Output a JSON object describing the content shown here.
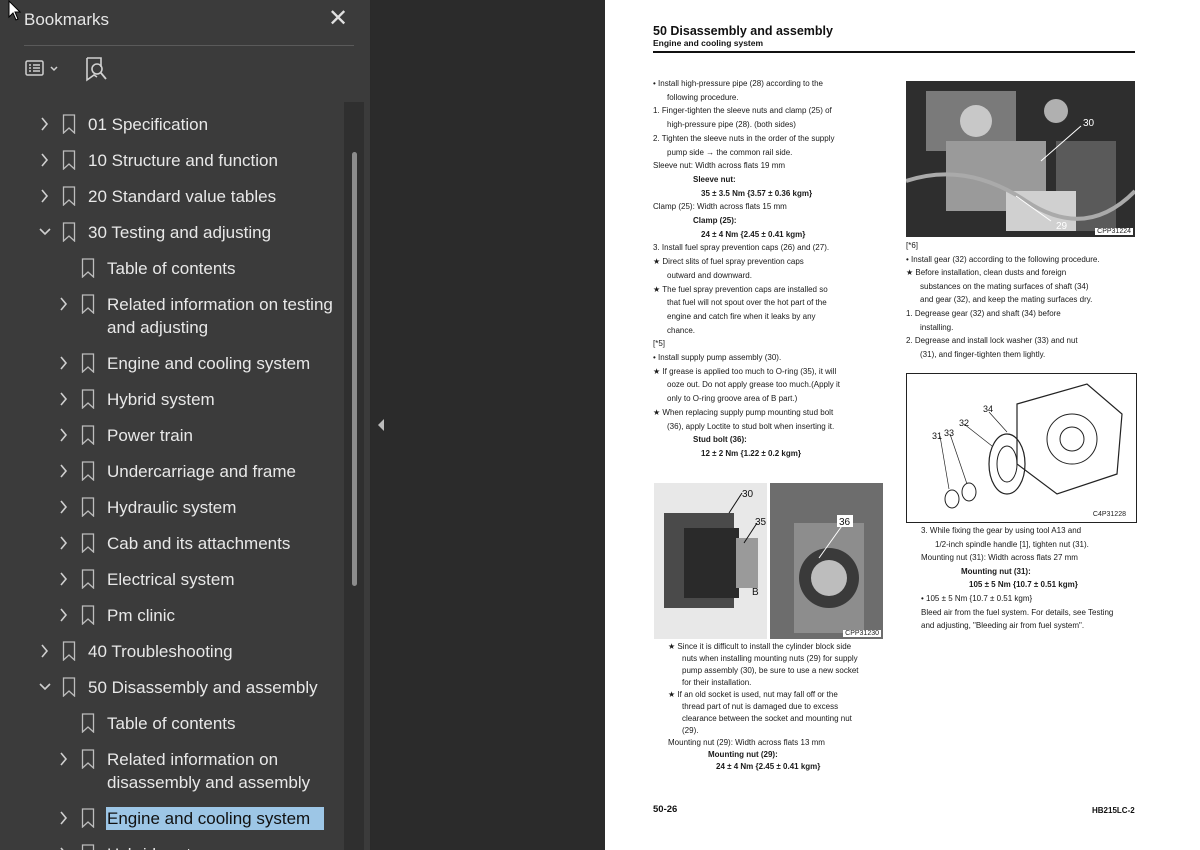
{
  "sidebar": {
    "title": "Bookmarks",
    "close_icon": "close-icon",
    "options_icon": "list-options-icon",
    "find_icon": "bookmark-search-icon",
    "items": [
      {
        "label": "01 Specification",
        "level": 0,
        "toggle": "collapsed"
      },
      {
        "label": "10 Structure and function",
        "level": 0,
        "toggle": "collapsed"
      },
      {
        "label": "20 Standard value tables",
        "level": 0,
        "toggle": "collapsed"
      },
      {
        "label": "30 Testing and adjusting",
        "level": 0,
        "toggle": "expanded"
      },
      {
        "label": "Table of contents",
        "level": 1,
        "toggle": "none"
      },
      {
        "label": "Related information on testing and adjusting",
        "level": 1,
        "toggle": "collapsed",
        "lines": [
          "Related information on testing",
          "and adjusting"
        ]
      },
      {
        "label": "Engine and cooling system",
        "level": 1,
        "toggle": "collapsed"
      },
      {
        "label": "Hybrid system",
        "level": 1,
        "toggle": "collapsed"
      },
      {
        "label": "Power train",
        "level": 1,
        "toggle": "collapsed"
      },
      {
        "label": "Undercarriage and frame",
        "level": 1,
        "toggle": "collapsed"
      },
      {
        "label": "Hydraulic system",
        "level": 1,
        "toggle": "collapsed"
      },
      {
        "label": "Cab and its attachments",
        "level": 1,
        "toggle": "collapsed"
      },
      {
        "label": "Electrical system",
        "level": 1,
        "toggle": "collapsed"
      },
      {
        "label": "Pm clinic",
        "level": 1,
        "toggle": "collapsed"
      },
      {
        "label": "40 Troubleshooting",
        "level": 0,
        "toggle": "collapsed"
      },
      {
        "label": "50 Disassembly and assembly",
        "level": 0,
        "toggle": "expanded"
      },
      {
        "label": "Table of contents",
        "level": 1,
        "toggle": "none"
      },
      {
        "label": "Related information on disassembly and assembly",
        "level": 1,
        "toggle": "collapsed",
        "lines": [
          "Related information on",
          "disassembly and assembly"
        ]
      },
      {
        "label": "Engine and cooling system",
        "level": 1,
        "toggle": "collapsed",
        "selected": true
      },
      {
        "label": "Hybrid system",
        "level": 1,
        "toggle": "collapsed"
      }
    ]
  },
  "colors": {
    "sidebar_bg": "#3b3b3b",
    "selection": "#9dc6e6",
    "viewer_bg": "#2b2b2b",
    "page_bg": "#ffffff"
  },
  "page": {
    "title": "50 Disassembly and assembly",
    "subtitle": "Engine and cooling system",
    "page_number": "50-26",
    "model": "HB215LC-2",
    "left_column": [
      "•  Install high-pressure pipe (28) according to the",
      "following procedure.",
      "1.  Finger-tighten the sleeve nuts and clamp (25) of",
      "high-pressure pipe (28). (both sides)",
      "2.  Tighten the sleeve nuts in the order of the supply",
      "pump side → the common rail side.",
      "Sleeve nut: Width across flats 19 mm",
      "Sleeve nut:",
      "35 ± 3.5 Nm {3.57 ± 0.36 kgm}",
      "Clamp (25): Width across flats 15 mm",
      "Clamp (25):",
      "24 ± 4 Nm {2.45 ± 0.41 kgm}",
      "3.  Install fuel spray prevention caps (26) and (27).",
      "★  Direct slits of fuel spray prevention caps",
      "outward and downward.",
      "★  The fuel spray prevention caps are installed so",
      "that fuel will not spout over the hot part of the",
      "engine and catch fire when it leaks by any",
      "chance.",
      "[*5]",
      "•  Install supply pump assembly (30).",
      "★  If grease is applied too much to O-ring (35), it will",
      "ooze out. Do not apply grease too much.(Apply it",
      "only to O-ring groove area of B part.)",
      "★  When replacing supply pump mounting stud bolt",
      "(36), apply Loctite to stud bolt when inserting it.",
      "Stud bolt (36):",
      "12 ± 2 Nm {1.22 ± 0.2 kgm}"
    ],
    "left_column_after_fig": [
      "★  Since it is difficult to install the cylinder block side",
      "nuts when installing mounting nuts (29) for supply",
      "pump assembly (30), be sure to use a new socket",
      "for their installation.",
      "★  If an old socket is used, nut may fall off or the",
      "thread part of nut is damaged due to excess",
      "clearance between the socket and mounting nut",
      "(29).",
      "Mounting nut (29): Width across flats 13 mm",
      "Mounting nut (29):",
      "24 ± 4 Nm {2.45 ± 0.41 kgm}"
    ],
    "right_column": [
      "[*6]",
      "•  Install gear (32) according to the following procedure.",
      "★  Before installation, clean dusts and foreign",
      "substances on the mating surfaces of shaft (34)",
      "and gear (32), and keep the mating surfaces dry.",
      "1.  Degrease gear (32) and shaft (34) before",
      "installing.",
      "2.  Degrease and install lock washer (33) and nut",
      "(31), and finger-tighten them lightly."
    ],
    "right_column_after_fig": [
      "3.  While fixing the gear by using tool A13 and",
      "1/2-inch spindle handle [1], tighten nut (31).",
      "Mounting nut (31): Width across flats 27 mm",
      "Mounting nut (31):",
      "105 ± 5 Nm {10.7 ± 0.51 kgm}",
      "•  105 ± 5 Nm {10.7 ± 0.51 kgm}",
      "Bleed air from the fuel system. For details, see Testing",
      "and adjusting, \"Bleeding air from fuel system\"."
    ],
    "figures": {
      "fig1_caption": "CPP31224",
      "fig1_labels": [
        "30",
        "29"
      ],
      "fig2_caption": "CPP31230",
      "fig2_labels": [
        "30",
        "35",
        "B",
        "36"
      ],
      "fig3_caption": "C4P31228",
      "fig3_labels": [
        "31",
        "33",
        "32",
        "34"
      ]
    }
  }
}
